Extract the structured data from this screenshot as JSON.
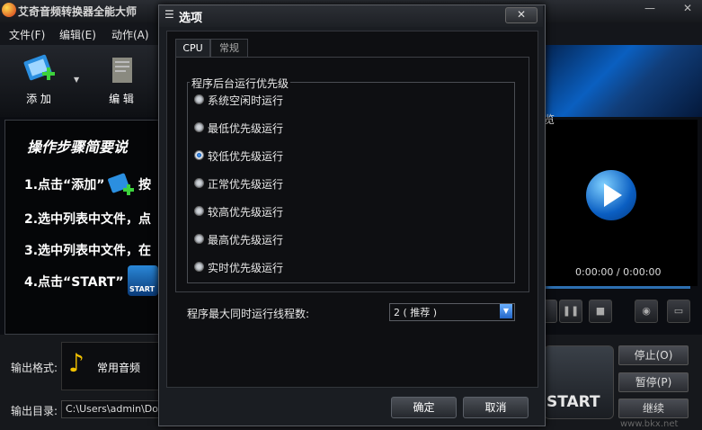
{
  "app": {
    "title": "艾奇音频转换器全能大师",
    "minimize": "—",
    "close": "✕"
  },
  "menu": [
    "文件(F)",
    "编辑(E)",
    "动作(A)"
  ],
  "toolbar": {
    "add_label": "添 加",
    "edit_label": "编 辑"
  },
  "steps": {
    "title": "操作步骤简要说",
    "items": [
      "1.点击“添加”",
      "2.选中列表中文件，点",
      "3.选中列表中文件，在",
      "4.点击“START”"
    ],
    "add_suffix": "按",
    "start_icon_text": "START"
  },
  "preview": {
    "label": "览",
    "time": "0:00:00 / 0:00:00"
  },
  "bottom": {
    "format_label": "输出格式:",
    "format_value": "常用音频",
    "dir_label": "输出目录:",
    "dir_value": "C:\\Users\\admin\\Docu",
    "start_label": "START",
    "stop_label": "停止(O)",
    "pause_label": "暂停(P)",
    "continue_label": "继续",
    "watermark": "www.bkx.net"
  },
  "dialog": {
    "title": "选项",
    "close": "✕",
    "tabs": [
      "CPU",
      "常规"
    ],
    "group_label": "程序后台运行优先级",
    "priorities": [
      "系统空闲时运行",
      "最低优先级运行",
      "较低优先级运行",
      "正常优先级运行",
      "较高优先级运行",
      "最高优先级运行",
      "实时优先级运行"
    ],
    "selected_priority": "较低优先级运行",
    "threads_label": "程序最大同时运行线程数:",
    "threads_value": "2 ( 推荐 )",
    "ok": "确定",
    "cancel": "取消"
  }
}
